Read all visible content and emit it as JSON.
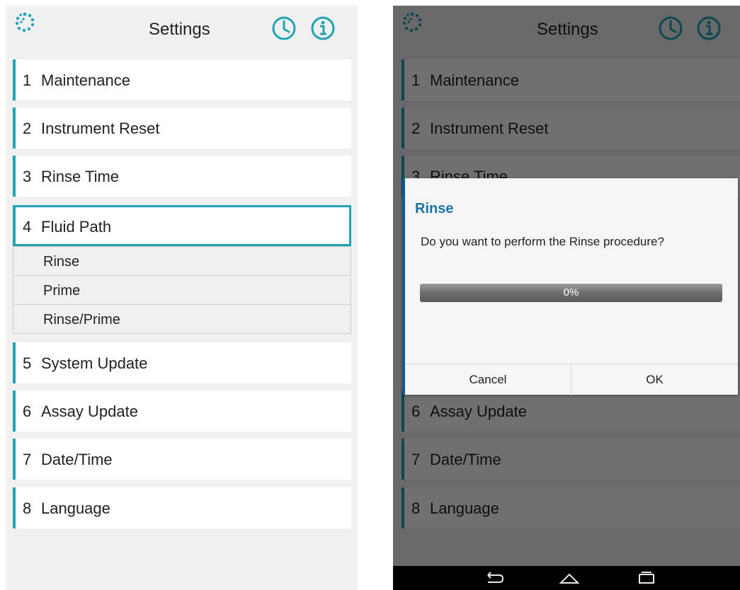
{
  "app": {
    "title": "Settings"
  },
  "icons": {
    "logo": "logo-icon",
    "clock": "clock-icon",
    "info": "info-icon"
  },
  "colors": {
    "accent": "#1fa3b5",
    "dialog_title": "#1a73a8"
  },
  "menu": [
    {
      "num": "1",
      "label": "Maintenance"
    },
    {
      "num": "2",
      "label": "Instrument Reset"
    },
    {
      "num": "3",
      "label": "Rinse Time"
    },
    {
      "num": "4",
      "label": "Fluid Path"
    },
    {
      "num": "5",
      "label": "System Update"
    },
    {
      "num": "6",
      "label": "Assay Update"
    },
    {
      "num": "7",
      "label": "Date/Time"
    },
    {
      "num": "8",
      "label": "Language"
    }
  ],
  "submenu": [
    {
      "label": "Rinse"
    },
    {
      "label": "Prime"
    },
    {
      "label": "Rinse/Prime"
    }
  ],
  "dialog": {
    "title": "Rinse",
    "message": "Do you want to perform the Rinse procedure?",
    "progress_text": "0%",
    "progress_value": 0,
    "cancel_label": "Cancel",
    "ok_label": "OK"
  }
}
